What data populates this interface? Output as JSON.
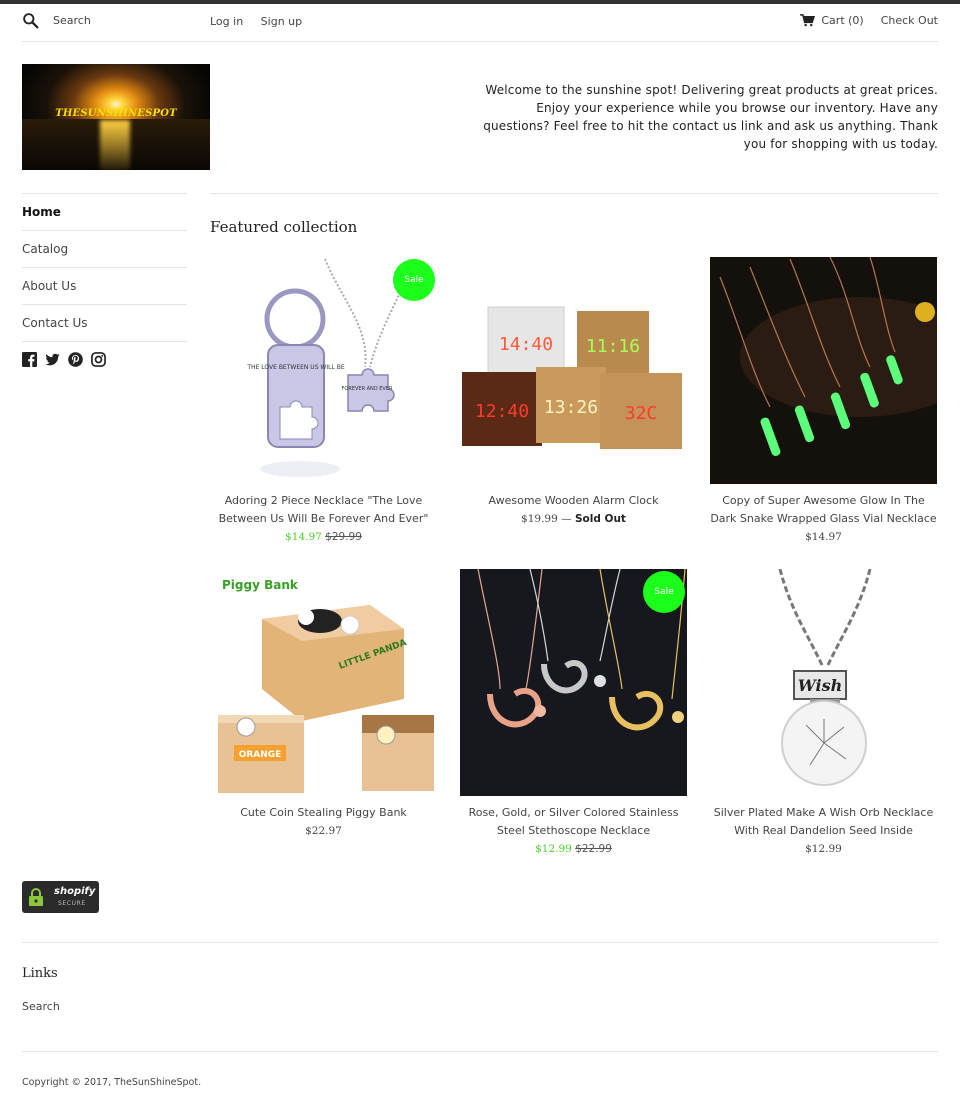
{
  "header": {
    "search_placeholder": "Search",
    "login": "Log in",
    "signup": "Sign up",
    "cart": "Cart (0)",
    "checkout": "Check Out"
  },
  "logo": {
    "text": "THESUNSHINESPOT"
  },
  "welcome": "Welcome to the sunshine spot! Delivering great products at great prices. Enjoy your experience while you browse our inventory. Have any questions? Feel free to hit the contact us link and ask us anything. Thank you for shopping with us today.",
  "nav": [
    "Home",
    "Catalog",
    "About Us",
    "Contact Us"
  ],
  "social_icons": [
    "facebook-icon",
    "twitter-icon",
    "pinterest-icon",
    "instagram-icon"
  ],
  "featured": {
    "title": "Featured collection",
    "products": [
      {
        "title": "Adoring 2 Piece Necklace \"The Love Between Us Will Be Forever And Ever\"",
        "price": "$14.97",
        "compare": "$29.99",
        "badge": "Sale"
      },
      {
        "title": "Awesome Wooden Alarm Clock",
        "price": "$19.99",
        "separator": "—",
        "status": "Sold Out"
      },
      {
        "title": "Copy of Super Awesome Glow In The Dark Snake Wrapped Glass Vial Necklace",
        "price": "$14.97"
      },
      {
        "title": "Cute Coin Stealing Piggy Bank",
        "price": "$22.97"
      },
      {
        "title": "Rose, Gold, or Silver Colored Stainless Steel Stethoscope Necklace",
        "price": "$12.99",
        "compare": "$22.99",
        "badge": "Sale"
      },
      {
        "title": "Silver Plated Make A Wish Orb Necklace With Real Dandelion Seed Inside",
        "price": "$12.99"
      }
    ],
    "image_text": {
      "keychain": "THE LOVE BETWEEN US WILL BE",
      "puzzle": "FOREVER AND EVER",
      "clock1": "14:40",
      "clock2": "11:16",
      "clock3": "12:40",
      "clock4": "13:26",
      "clock5": "32C",
      "piggy_label": "Piggy Bank",
      "box_label": "LITTLE PANDA",
      "orange_label": "ORANGE",
      "wish_tag": "Wish"
    }
  },
  "trust_badge": {
    "brand": "shopify",
    "sub": "SECURE"
  },
  "footer": {
    "links_title": "Links",
    "search_link": "Search",
    "copyright": "Copyright © 2017, TheSunShineSpot."
  }
}
